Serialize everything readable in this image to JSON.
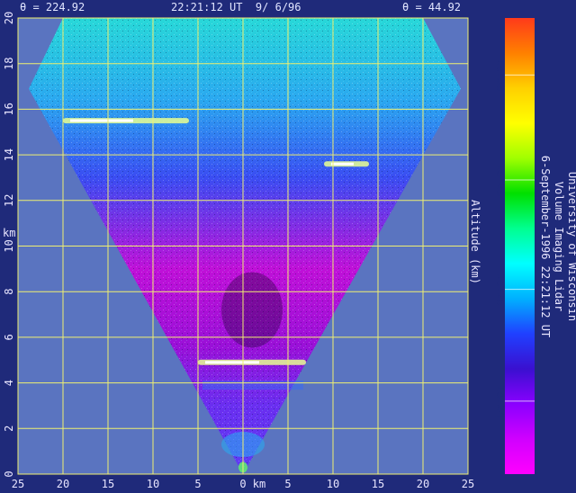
{
  "header": {
    "theta_left": "θ = 224.92",
    "timestamp": "22:21:12 UT  9/ 6/96",
    "theta_right": "θ = 44.92"
  },
  "chart_data": {
    "type": "heatmap",
    "title": "",
    "xlabel": "km",
    "ylabel": "Altitude (km)",
    "x_ticks": [
      "25",
      "20",
      "15",
      "10",
      "5",
      "0",
      "5",
      "10",
      "15",
      "20",
      "25"
    ],
    "x_range": [
      -25,
      25
    ],
    "y_ticks": [
      "0",
      "2",
      "4",
      "6",
      "8",
      "10",
      "12",
      "14",
      "16",
      "18",
      "20"
    ],
    "y_range": [
      0,
      20
    ],
    "y_axis_km_label": "km",
    "grid": true,
    "scan_edges_deg": [
      224.92,
      44.92
    ],
    "features": [
      {
        "kind": "cirrus band",
        "altitude_km": 15.5,
        "x_km": [
          -20,
          -6
        ]
      },
      {
        "kind": "cloud patch",
        "altitude_km": 13.6,
        "x_km": [
          9,
          14
        ]
      },
      {
        "kind": "thin cloud layer",
        "altitude_km": 4.9,
        "x_km": [
          -5,
          7
        ]
      }
    ],
    "colorbar": {
      "ticks": [
        "1e+30",
        "1e+28",
        "1e+26",
        "1e+24"
      ],
      "colors": [
        "#ff3a1a",
        "#ff8000",
        "#ffd000",
        "#ffff00",
        "#a0ff00",
        "#00e000",
        "#00ff90",
        "#00ffff",
        "#00b0ff",
        "#2040ff",
        "#3a10d0",
        "#8a00ff",
        "#d000ff",
        "#ff00ff"
      ]
    },
    "side_label": [
      "University of Wisconsin",
      "Volume Imaging Lidar",
      "6-September-1996 22:21:12 UT"
    ]
  }
}
